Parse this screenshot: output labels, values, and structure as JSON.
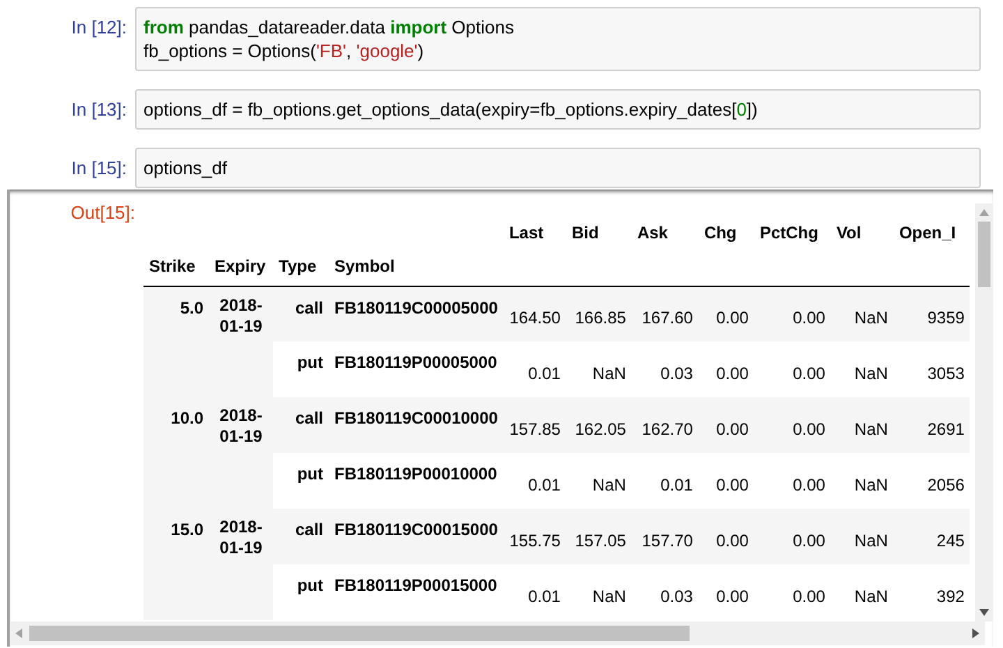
{
  "cells": [
    {
      "prompt": "In [12]:",
      "lines": [
        [
          {
            "kind": "keyword",
            "text": "from"
          },
          {
            "kind": "plain",
            "text": " pandas_datareader.data "
          },
          {
            "kind": "keyword",
            "text": "import"
          },
          {
            "kind": "plain",
            "text": " Options"
          }
        ],
        [
          {
            "kind": "plain",
            "text": "fb_options = Options("
          },
          {
            "kind": "string",
            "text": "'FB'"
          },
          {
            "kind": "plain",
            "text": ", "
          },
          {
            "kind": "string",
            "text": "'google'"
          },
          {
            "kind": "plain",
            "text": ")"
          }
        ]
      ]
    },
    {
      "prompt": "In [13]:",
      "lines": [
        [
          {
            "kind": "plain",
            "text": "options_df = fb_options.get_options_data(expiry=fb_options.expiry_dates["
          },
          {
            "kind": "number",
            "text": "0"
          },
          {
            "kind": "plain",
            "text": "])"
          }
        ]
      ]
    },
    {
      "prompt": "In [15]:",
      "lines": [
        [
          {
            "kind": "plain",
            "text": "options_df"
          }
        ]
      ]
    }
  ],
  "output": {
    "prompt": "Out[15]:",
    "value_columns": [
      "Last",
      "Bid",
      "Ask",
      "Chg",
      "PctChg",
      "Vol",
      "Open_I"
    ],
    "index_columns": [
      "Strike",
      "Expiry",
      "Type",
      "Symbol"
    ],
    "groups": [
      {
        "strike": "5.0",
        "expiry": "2018-01-19",
        "rows": [
          {
            "type": "call",
            "symbol": "FB180119C00005000",
            "values": [
              "164.50",
              "166.85",
              "167.60",
              "0.00",
              "0.00",
              "NaN",
              "9359"
            ]
          },
          {
            "type": "put",
            "symbol": "FB180119P00005000",
            "values": [
              "0.01",
              "NaN",
              "0.03",
              "0.00",
              "0.00",
              "NaN",
              "3053"
            ]
          }
        ]
      },
      {
        "strike": "10.0",
        "expiry": "2018-01-19",
        "rows": [
          {
            "type": "call",
            "symbol": "FB180119C00010000",
            "values": [
              "157.85",
              "162.05",
              "162.70",
              "0.00",
              "0.00",
              "NaN",
              "2691"
            ]
          },
          {
            "type": "put",
            "symbol": "FB180119P00010000",
            "values": [
              "0.01",
              "NaN",
              "0.01",
              "0.00",
              "0.00",
              "NaN",
              "2056"
            ]
          }
        ]
      },
      {
        "strike": "15.0",
        "expiry": "2018-01-19",
        "rows": [
          {
            "type": "call",
            "symbol": "FB180119C00015000",
            "values": [
              "155.75",
              "157.05",
              "157.70",
              "0.00",
              "0.00",
              "NaN",
              "245"
            ]
          },
          {
            "type": "put",
            "symbol": "FB180119P00015000",
            "values": [
              "0.01",
              "NaN",
              "0.03",
              "0.00",
              "0.00",
              "NaN",
              "392"
            ]
          }
        ]
      }
    ]
  }
}
